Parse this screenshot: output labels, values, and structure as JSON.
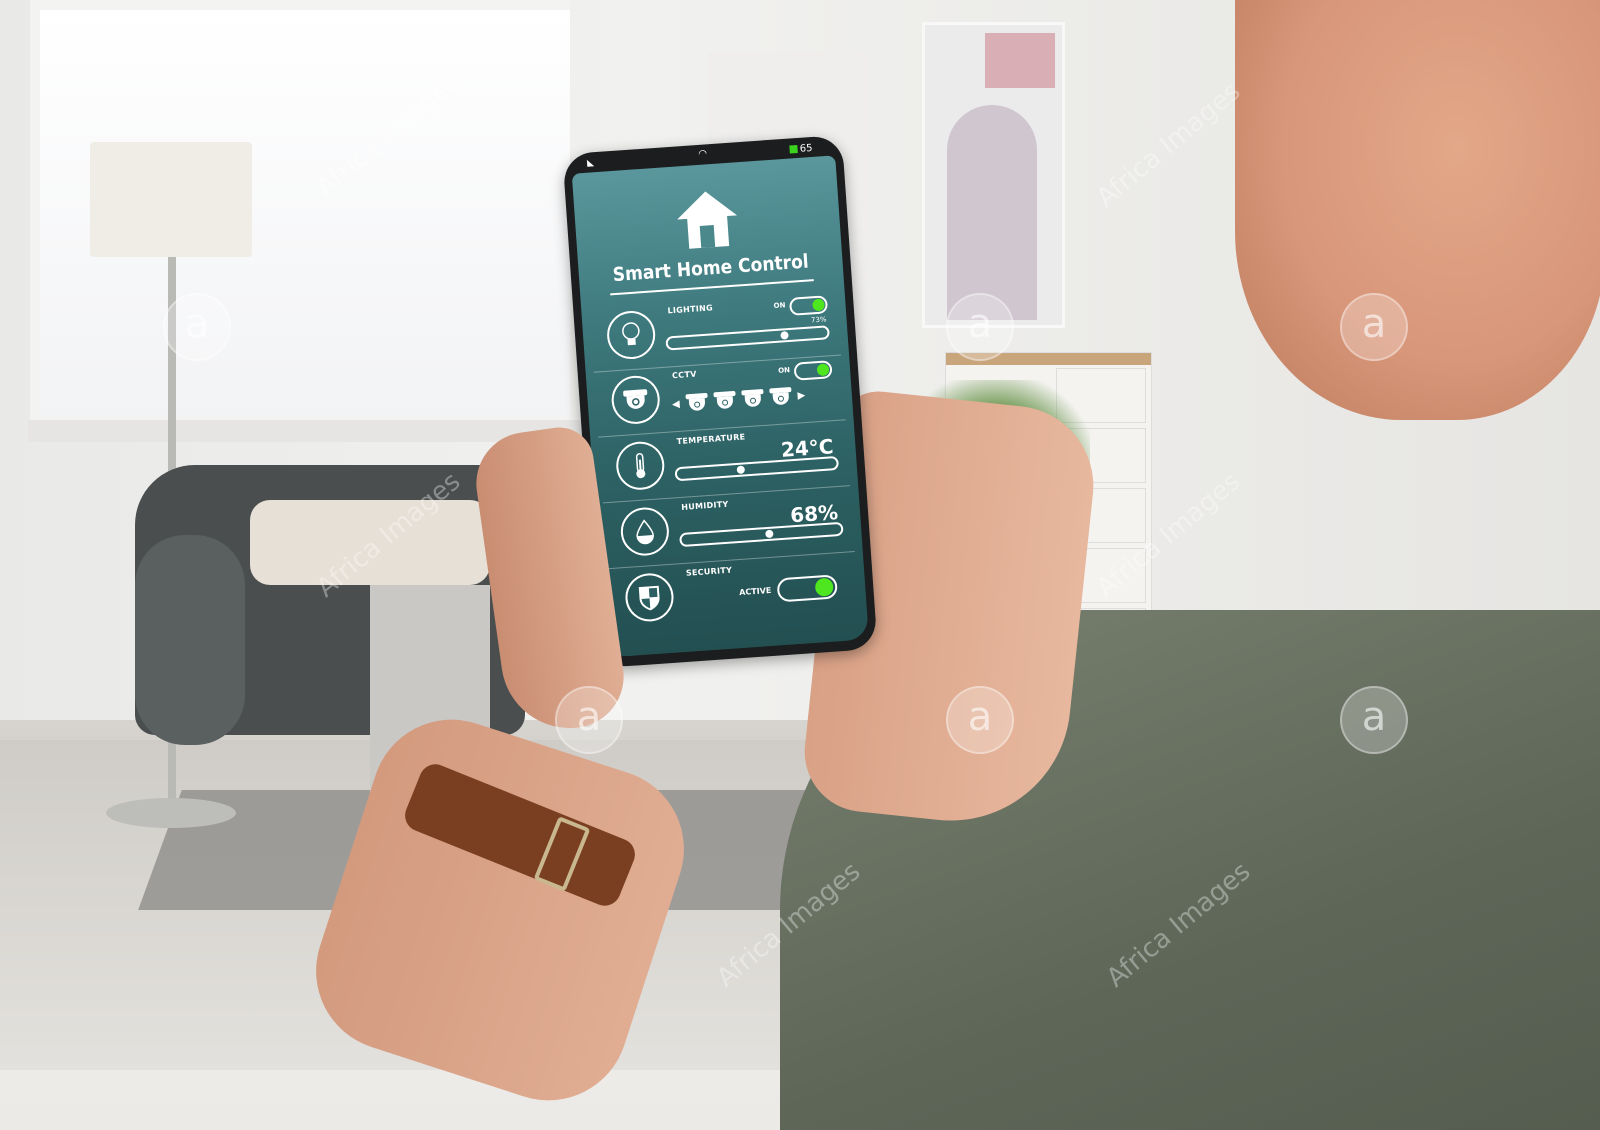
{
  "photo": {
    "watermark": {
      "brand_text": "Africa Images",
      "logo_glyph": "a"
    }
  },
  "phone": {
    "statusbar": {
      "signal_icon": "signal-icon",
      "wifi_icon": "wifi-icon",
      "battery_level": "65"
    },
    "app": {
      "icon": "house-icon",
      "title": "Smart Home Control",
      "controls": [
        {
          "id": "lighting",
          "label": "LIGHTING",
          "icon": "lightbulb-icon",
          "toggle_label": "ON",
          "toggle_on": true,
          "value_label": "73%",
          "slider_value": 0.73
        },
        {
          "id": "cctv",
          "label": "CCTV",
          "icon": "security-camera-icon",
          "toggle_label": "ON",
          "toggle_on": true,
          "cameras": 4,
          "prev_glyph": "◀",
          "next_glyph": "▶"
        },
        {
          "id": "temperature",
          "label": "TEMPERATURE",
          "icon": "thermometer-icon",
          "value_label": "24°C",
          "slider_value": 0.4
        },
        {
          "id": "humidity",
          "label": "HUMIDITY",
          "icon": "water-drop-icon",
          "value_label": "68%",
          "slider_value": 0.55
        },
        {
          "id": "security",
          "label": "SECURITY",
          "icon": "shield-icon",
          "toggle_label": "ACTIVE",
          "toggle_on": true
        }
      ],
      "accent_color": "#4ee61f",
      "screen_color": "#3e7a7e"
    }
  }
}
